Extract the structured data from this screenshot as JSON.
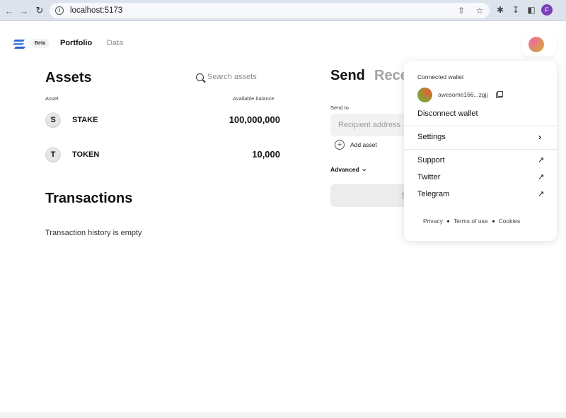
{
  "browser": {
    "url": "localhost:5173",
    "profile_initial": "F",
    "icons": [
      "back-icon",
      "forward-icon",
      "reload-icon",
      "info-icon",
      "share-icon",
      "star-icon",
      "extensions-icon",
      "download-icon",
      "sidebar-icon"
    ]
  },
  "header": {
    "beta_badge": "Beta",
    "nav": {
      "portfolio": "Portfolio",
      "data": "Data"
    }
  },
  "assets": {
    "title": "Assets",
    "search_placeholder": "Search assets",
    "col_asset": "Asset",
    "col_balance": "Available balance",
    "rows": [
      {
        "initial": "S",
        "name": "STAKE",
        "balance": "100,000,000"
      },
      {
        "initial": "T",
        "name": "TOKEN",
        "balance": "10,000"
      }
    ]
  },
  "transactions": {
    "title": "Transactions",
    "empty": "Transaction history is empty"
  },
  "send": {
    "title": "Send",
    "receive_tab": "Rece",
    "send_to_label": "Send to",
    "recipient_placeholder": "Recipient address",
    "add_asset": "Add asset",
    "advanced": "Advanced",
    "submit_label": "S"
  },
  "wallet_menu": {
    "connected_label": "Connected wallet",
    "address": "awesome166...zgjj",
    "disconnect": "Disconnect wallet",
    "settings": "Settings",
    "support": "Support",
    "twitter": "Twitter",
    "telegram": "Telegram",
    "footer": {
      "privacy": "Privacy",
      "terms": "Terms of use",
      "cookies": "Cookies"
    }
  },
  "colors": {
    "accent_logo": "#3b6fd8",
    "muted": "#8a8a8a"
  }
}
